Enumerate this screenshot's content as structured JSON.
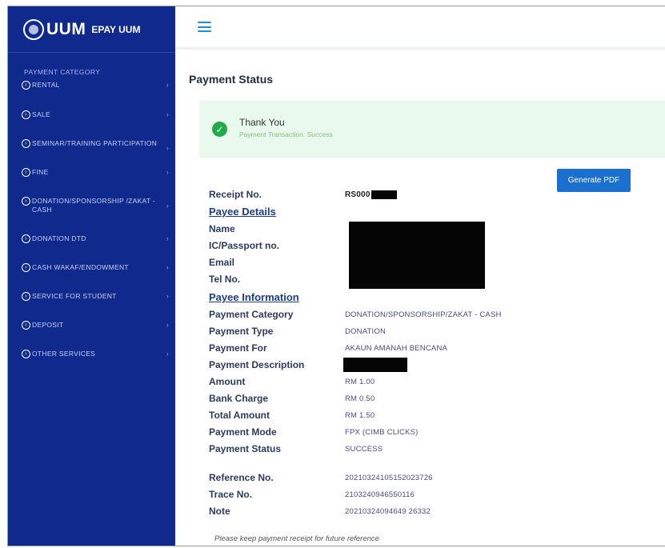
{
  "brand": {
    "logo_text": "UUM",
    "subtitle": "EPAY UUM"
  },
  "sidebar": {
    "heading": "PAYMENT CATEGORY",
    "items": [
      {
        "label": "RENTAL"
      },
      {
        "label": "SALE"
      },
      {
        "label": "SEMINAR/TRAINING PARTICIPATION"
      },
      {
        "label": "FINE"
      },
      {
        "label": "DONATION/SPONSORSHIP /ZAKAT - CASH"
      },
      {
        "label": "DONATION DTD"
      },
      {
        "label": "CASH WAKAF/ENDOWMENT"
      },
      {
        "label": "SERVICE FOR STUDENT"
      },
      {
        "label": "DEPOSIT"
      },
      {
        "label": "OTHER SERVICES"
      }
    ],
    "chevron": "›"
  },
  "page": {
    "title": "Payment Status"
  },
  "alert": {
    "title": "Thank You",
    "message": "Payment Transaction: Success",
    "icon": "check-circle-icon",
    "check_glyph": "✓"
  },
  "actions": {
    "generate_pdf": "Generate PDF"
  },
  "receipt": {
    "receipt_no_label": "Receipt No.",
    "receipt_no_value": "RS000",
    "payee_details_heading": "Payee Details",
    "name_label": "Name",
    "ic_label": "IC/Passport no.",
    "email_label": "Email",
    "tel_label": "Tel No.",
    "payee_information_heading": "Payee Information",
    "fields": [
      {
        "label": "Payment Category",
        "value": "DONATION/SPONSORSHIP/ZAKAT - CASH"
      },
      {
        "label": "Payment Type",
        "value": "DONATION"
      },
      {
        "label": "Payment For",
        "value": "AKAUN AMANAH BENCANA"
      },
      {
        "label": "Payment Description",
        "value": ""
      },
      {
        "label": "Amount",
        "value": "RM 1.00"
      },
      {
        "label": "Bank Charge",
        "value": "RM 0.50"
      },
      {
        "label": "Total Amount",
        "value": "RM 1.50"
      },
      {
        "label": "Payment Mode",
        "value": "FPX (CIMB CLICKS)"
      },
      {
        "label": "Payment Status",
        "value": "SUCCESS"
      }
    ],
    "refs": [
      {
        "label": "Reference No.",
        "value": "20210324105152023726"
      },
      {
        "label": "Trace No.",
        "value": "2103240946550116"
      },
      {
        "label": "Note",
        "value": "20210324094649 26332"
      }
    ]
  },
  "footer": {
    "note": "Please keep payment receipt for future reference"
  },
  "colors": {
    "sidebar": "#0f2a8c",
    "accent": "#1b6fcf",
    "success": "#22a94a"
  }
}
